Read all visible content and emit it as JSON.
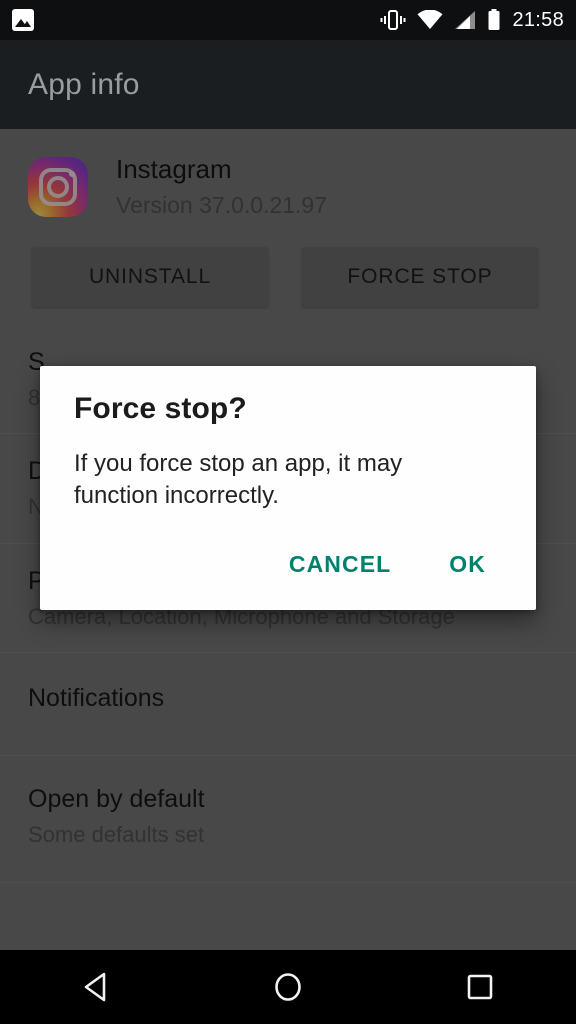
{
  "status_bar": {
    "notification_icon": "photo-icon",
    "icons": [
      "vibrate-icon",
      "wifi-icon",
      "cellular-signal-icon",
      "battery-icon"
    ],
    "time": "21:58"
  },
  "action_bar": {
    "title": "App info"
  },
  "app": {
    "icon": "instagram-icon",
    "name": "Instagram",
    "version": "Version 37.0.0.21.97"
  },
  "buttons": {
    "uninstall": "UNINSTALL",
    "force_stop": "FORCE STOP"
  },
  "list": [
    {
      "title": "S",
      "subtitle": "8"
    },
    {
      "title": "D",
      "subtitle": "N"
    },
    {
      "title": "Permissions",
      "subtitle": "Camera, Location, Microphone and Storage"
    },
    {
      "title": "Notifications",
      "subtitle": ""
    },
    {
      "title": "Open by default",
      "subtitle": "Some defaults set"
    }
  ],
  "dialog": {
    "title": "Force stop?",
    "message": "If you force stop an app, it may function incorrectly.",
    "cancel_label": "CANCEL",
    "ok_label": "OK",
    "accent_color": "#00816b"
  },
  "nav_bar": {
    "back": "back-triangle-icon",
    "home": "home-circle-icon",
    "recents": "recents-square-icon"
  }
}
